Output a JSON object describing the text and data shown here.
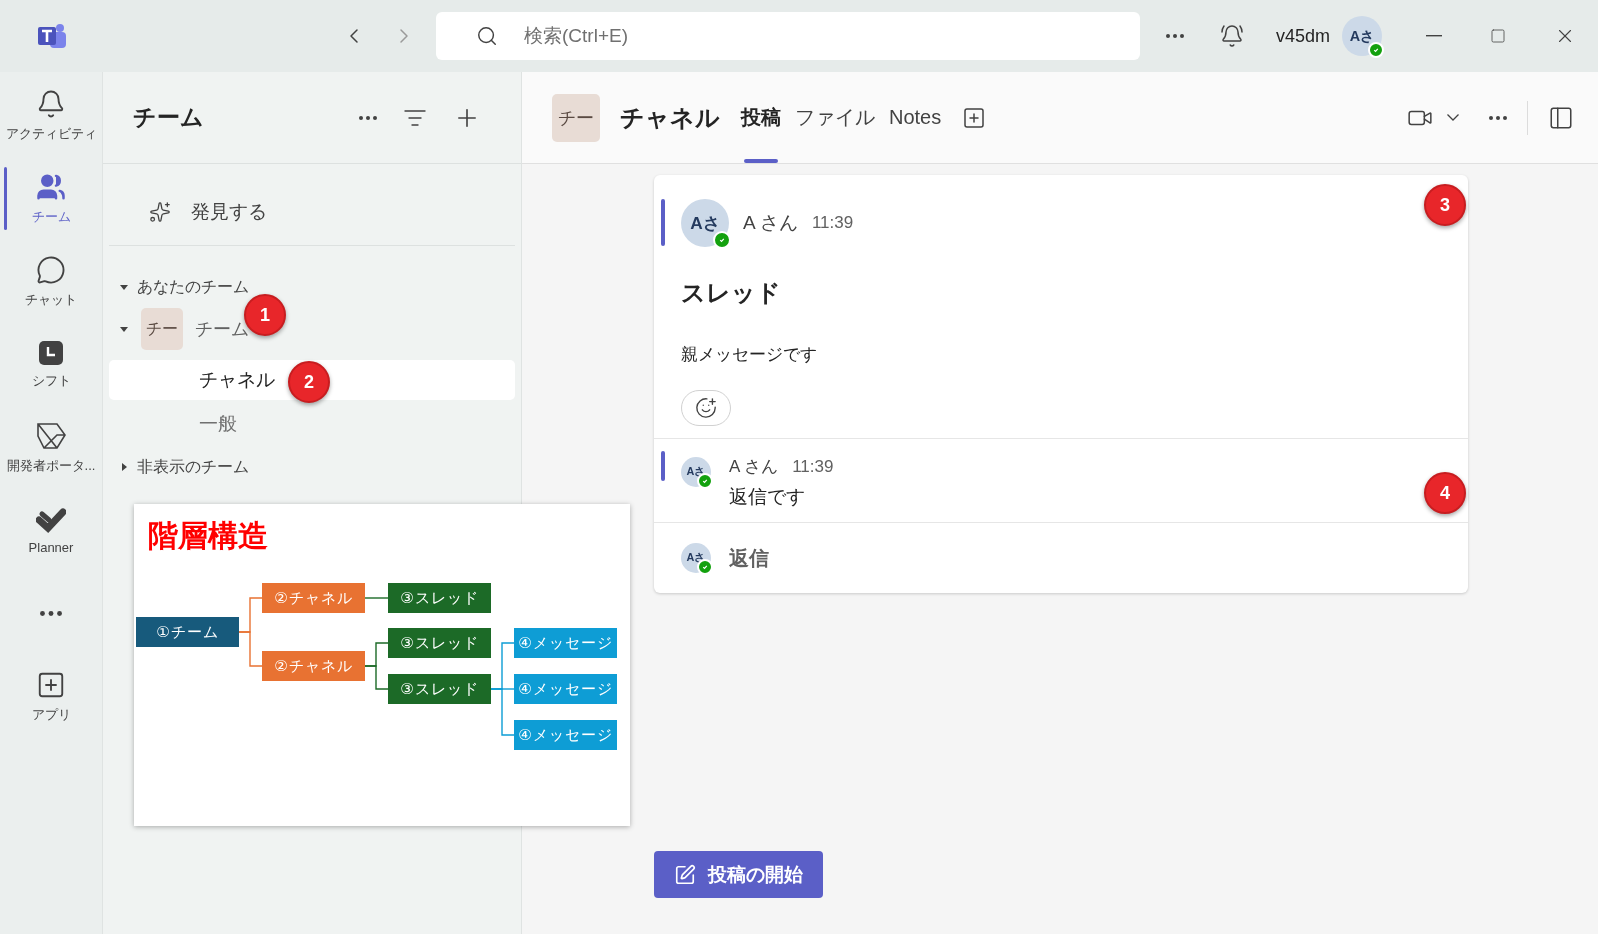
{
  "title_bar": {
    "search": {
      "placeholder": "検索(Ctrl+E)"
    },
    "user": {
      "name": "v45dm",
      "avatar": "Aさ",
      "online": true
    }
  },
  "rail": [
    {
      "kind": "bell",
      "label": "アクティビティ",
      "selected": false
    },
    {
      "kind": "people",
      "label": "チーム",
      "selected": true
    },
    {
      "kind": "chat",
      "label": "チャット",
      "selected": false
    },
    {
      "kind": "shift",
      "label": "シフト",
      "selected": false
    },
    {
      "kind": "portal",
      "label": "開発者ポータ...",
      "selected": false
    },
    {
      "kind": "planner",
      "label": "Planner",
      "selected": false
    },
    {
      "kind": "more",
      "selected": false
    },
    {
      "kind": "apps",
      "label": "アプリ",
      "selected": false
    }
  ],
  "teams_panel": {
    "title": "チーム",
    "discover": "発見する",
    "sections": [
      {
        "label": "あなたのチーム",
        "expanded": true,
        "teams": [
          {
            "avatar": "チー",
            "name": "チーム",
            "expanded": true,
            "channels": [
              {
                "name": "チャネル",
                "selected": true
              },
              {
                "name": "一般",
                "selected": false
              }
            ]
          }
        ]
      },
      {
        "label": "非表示のチーム",
        "expanded": false
      }
    ]
  },
  "channel_header": {
    "avatar": "チー",
    "name": "チャネル",
    "tabs": [
      {
        "label": "投稿",
        "selected": true
      },
      {
        "label": "ファイル",
        "selected": false
      },
      {
        "label": "Notes",
        "selected": false
      }
    ]
  },
  "thread": {
    "post": {
      "avatar": "Aさ",
      "author": "A さん",
      "time": "11:39",
      "online": true,
      "subject": "スレッド",
      "body": "親メッセージです"
    },
    "replies": [
      {
        "avatar": "Aさ",
        "author": "A さん",
        "time": "11:39",
        "online": true,
        "body": "返信です"
      }
    ],
    "reply_box": {
      "avatar": "Aさ",
      "online": true,
      "label": "返信"
    }
  },
  "new_post_button": "投稿の開始",
  "annotations": [
    {
      "label": "1"
    },
    {
      "label": "2"
    },
    {
      "label": "3"
    },
    {
      "label": "4"
    }
  ],
  "diagram": {
    "title": "階層構造",
    "root": {
      "label": "①チーム",
      "color": "#175a7c",
      "children": [
        {
          "label": "②チャネル",
          "color": "#e87232",
          "children": [
            {
              "label": "③スレッド",
              "color": "#1c6a27"
            }
          ]
        },
        {
          "label": "②チャネル",
          "color": "#e87232",
          "children": [
            {
              "label": "③スレッド",
              "color": "#1c6a27"
            },
            {
              "label": "③スレッド",
              "color": "#1c6a27",
              "children": [
                {
                  "label": "④メッセージ",
                  "color": "#0e9dd5"
                },
                {
                  "label": "④メッセージ",
                  "color": "#0e9dd5"
                },
                {
                  "label": "④メッセージ",
                  "color": "#0e9dd5"
                }
              ]
            }
          ]
        }
      ]
    }
  }
}
